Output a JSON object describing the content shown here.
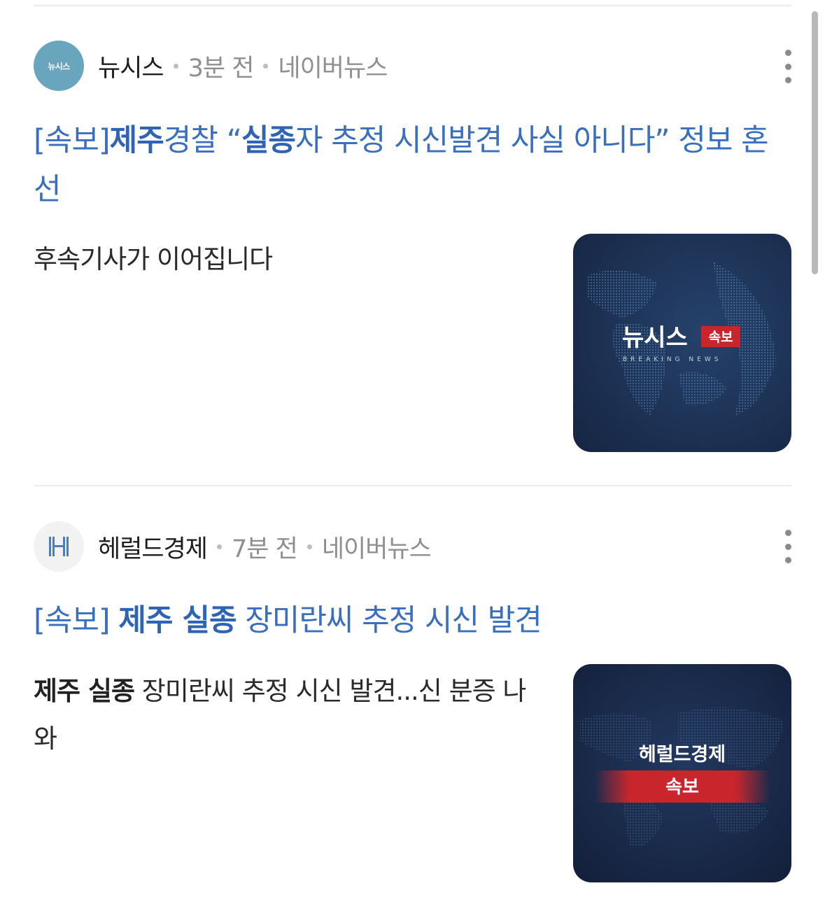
{
  "articles": [
    {
      "source": "뉴시스",
      "source_logo_text": "뉴시스",
      "time": "3분 전",
      "platform": "네이버뉴스",
      "title_parts": [
        {
          "text": "[속보]",
          "bold": false
        },
        {
          "text": "제주",
          "bold": true
        },
        {
          "text": "경찰 “",
          "bold": false
        },
        {
          "text": "실종",
          "bold": true
        },
        {
          "text": "자 추정 시신발견 사실 아니다” 정보 혼선",
          "bold": false
        }
      ],
      "summary_parts": [
        {
          "text": "후속기사가 이어집니다",
          "bold": false
        }
      ],
      "thumbnail": {
        "brand": "뉴시스",
        "badge": "속보",
        "subtitle": "BREAKING NEWS"
      }
    },
    {
      "source": "헤럴드경제",
      "time": "7분 전",
      "platform": "네이버뉴스",
      "title_parts": [
        {
          "text": "[속보] ",
          "bold": false
        },
        {
          "text": "제주 실종",
          "bold": true
        },
        {
          "text": " 장미란씨 추정 시신 발견",
          "bold": false
        }
      ],
      "summary_parts": [
        {
          "text": "제주 실종",
          "bold": true
        },
        {
          "text": " 장미란씨 추정 시신 발견...신 분증 나와",
          "bold": false
        }
      ],
      "thumbnail": {
        "brand": "헤럴드경제",
        "badge": "속보"
      }
    }
  ],
  "more_icon": "more-vertical-icon",
  "colors": {
    "headline": "#3a6fbf",
    "meta": "#8f8f8f",
    "newsis_logo_bg": "#69a6be",
    "thumb_bg": "#1b2b4a",
    "badge_red": "#c8262c"
  }
}
